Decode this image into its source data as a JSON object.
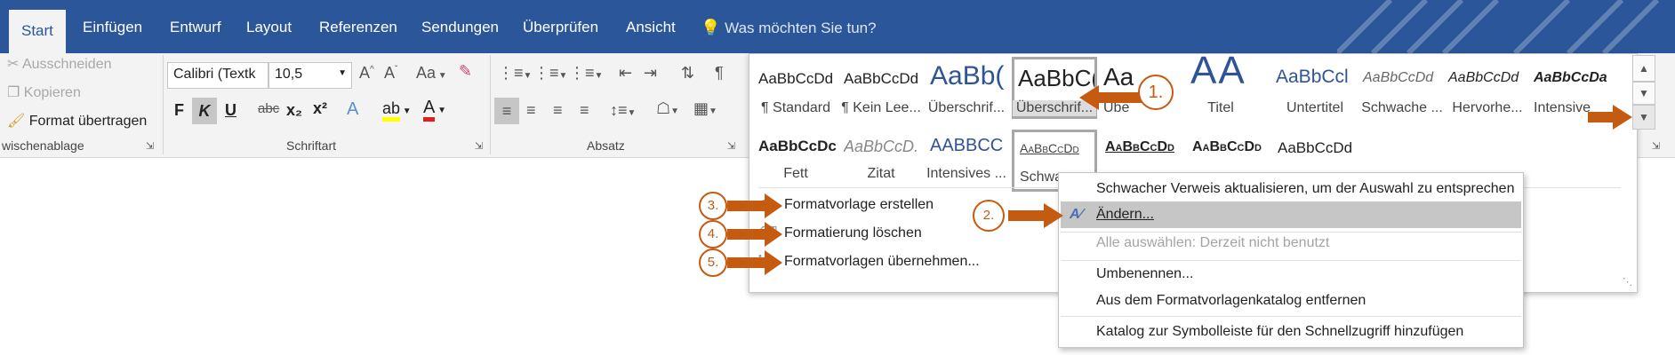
{
  "tabs": [
    "Start",
    "Einfügen",
    "Entwurf",
    "Layout",
    "Referenzen",
    "Sendungen",
    "Überprüfen",
    "Ansicht"
  ],
  "tell_me": "Was möchten Sie tun?",
  "clipboard": {
    "cut": "Ausschneiden",
    "copy": "Kopieren",
    "format_painter": "Format übertragen",
    "group": "wischenablage"
  },
  "font": {
    "name": "Calibri (Textk",
    "size": "10,5",
    "group": "Schriftart",
    "bold": "F",
    "italic": "K",
    "underline": "U",
    "strike": "abc",
    "sub": "x₂",
    "sup": "x²",
    "case": "Aa"
  },
  "paragraph": {
    "group": "Absatz"
  },
  "styles": {
    "row1": [
      {
        "preview": "AaBbCcDd",
        "name": "¶ Standard"
      },
      {
        "preview": "AaBbCcDd",
        "name": "¶ Kein Lee..."
      },
      {
        "preview": "AaBb(",
        "name": "Überschrif..."
      },
      {
        "preview": "AaBbC(",
        "name": "Überschrif..."
      },
      {
        "preview": "Aa",
        "name": "Übe"
      },
      {
        "preview": "AA",
        "name": "Titel"
      },
      {
        "preview": "AaBbCcl",
        "name": "Untertitel"
      },
      {
        "preview": "AaBbCcDd",
        "name": "Schwache ..."
      },
      {
        "preview": "AaBbCcDd",
        "name": "Hervorhe..."
      },
      {
        "preview": "AaBbCcDa",
        "name": "Intensive"
      }
    ],
    "row2": [
      {
        "preview": "AaBbCcDc",
        "name": "Fett"
      },
      {
        "preview": "AaBbCcD.",
        "name": "Zitat"
      },
      {
        "preview": "AABBCC",
        "name": "Intensives ..."
      },
      {
        "preview": "AaBbCcDd",
        "name": "Schwa"
      },
      {
        "preview": "AaBbCcDd",
        "name": ""
      },
      {
        "preview": "AaBbCcDd",
        "name": ""
      },
      {
        "preview": "AaBbCcDd",
        "name": ""
      }
    ]
  },
  "gallery_menu": [
    "Formatvorlage erstellen",
    "Formatierung löschen",
    "Formatvorlagen übernehmen..."
  ],
  "context_menu": [
    "Schwacher Verweis aktualisieren, um der Auswahl zu entsprechen",
    "Ändern...",
    "Alle auswählen: Derzeit nicht benutzt",
    "Umbenennen...",
    "Aus dem Formatvorlagenkatalog entfernen",
    "Katalog zur Symbolleiste für den Schnellzugriff hinzufügen"
  ],
  "steps": [
    "1.",
    "2.",
    "3.",
    "4.",
    "5."
  ],
  "colors": {
    "ribbon_blue": "#2b579a",
    "annotation": "#c55a11",
    "highlight": "#a8a8a8"
  }
}
